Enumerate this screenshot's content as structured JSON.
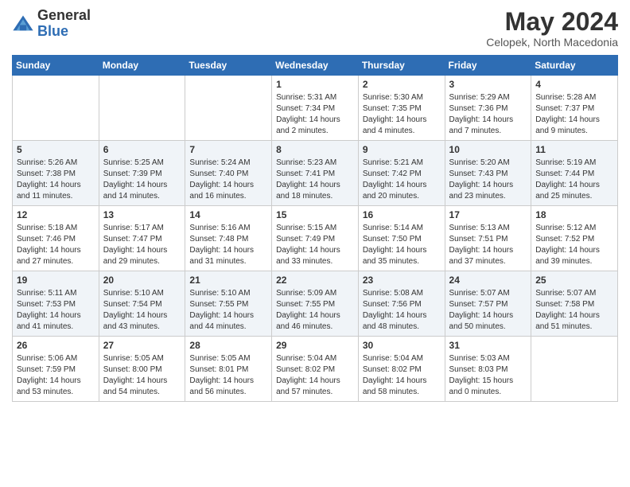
{
  "header": {
    "logo": {
      "line1": "General",
      "line2": "Blue"
    },
    "month_year": "May 2024",
    "location": "Celopek, North Macedonia"
  },
  "days_of_week": [
    "Sunday",
    "Monday",
    "Tuesday",
    "Wednesday",
    "Thursday",
    "Friday",
    "Saturday"
  ],
  "weeks": [
    [
      {
        "day": "",
        "info": ""
      },
      {
        "day": "",
        "info": ""
      },
      {
        "day": "",
        "info": ""
      },
      {
        "day": "1",
        "sunrise": "5:31 AM",
        "sunset": "7:34 PM",
        "daylight": "14 hours and 2 minutes."
      },
      {
        "day": "2",
        "sunrise": "5:30 AM",
        "sunset": "7:35 PM",
        "daylight": "14 hours and 4 minutes."
      },
      {
        "day": "3",
        "sunrise": "5:29 AM",
        "sunset": "7:36 PM",
        "daylight": "14 hours and 7 minutes."
      },
      {
        "day": "4",
        "sunrise": "5:28 AM",
        "sunset": "7:37 PM",
        "daylight": "14 hours and 9 minutes."
      }
    ],
    [
      {
        "day": "5",
        "sunrise": "5:26 AM",
        "sunset": "7:38 PM",
        "daylight": "14 hours and 11 minutes."
      },
      {
        "day": "6",
        "sunrise": "5:25 AM",
        "sunset": "7:39 PM",
        "daylight": "14 hours and 14 minutes."
      },
      {
        "day": "7",
        "sunrise": "5:24 AM",
        "sunset": "7:40 PM",
        "daylight": "14 hours and 16 minutes."
      },
      {
        "day": "8",
        "sunrise": "5:23 AM",
        "sunset": "7:41 PM",
        "daylight": "14 hours and 18 minutes."
      },
      {
        "day": "9",
        "sunrise": "5:21 AM",
        "sunset": "7:42 PM",
        "daylight": "14 hours and 20 minutes."
      },
      {
        "day": "10",
        "sunrise": "5:20 AM",
        "sunset": "7:43 PM",
        "daylight": "14 hours and 23 minutes."
      },
      {
        "day": "11",
        "sunrise": "5:19 AM",
        "sunset": "7:44 PM",
        "daylight": "14 hours and 25 minutes."
      }
    ],
    [
      {
        "day": "12",
        "sunrise": "5:18 AM",
        "sunset": "7:46 PM",
        "daylight": "14 hours and 27 minutes."
      },
      {
        "day": "13",
        "sunrise": "5:17 AM",
        "sunset": "7:47 PM",
        "daylight": "14 hours and 29 minutes."
      },
      {
        "day": "14",
        "sunrise": "5:16 AM",
        "sunset": "7:48 PM",
        "daylight": "14 hours and 31 minutes."
      },
      {
        "day": "15",
        "sunrise": "5:15 AM",
        "sunset": "7:49 PM",
        "daylight": "14 hours and 33 minutes."
      },
      {
        "day": "16",
        "sunrise": "5:14 AM",
        "sunset": "7:50 PM",
        "daylight": "14 hours and 35 minutes."
      },
      {
        "day": "17",
        "sunrise": "5:13 AM",
        "sunset": "7:51 PM",
        "daylight": "14 hours and 37 minutes."
      },
      {
        "day": "18",
        "sunrise": "5:12 AM",
        "sunset": "7:52 PM",
        "daylight": "14 hours and 39 minutes."
      }
    ],
    [
      {
        "day": "19",
        "sunrise": "5:11 AM",
        "sunset": "7:53 PM",
        "daylight": "14 hours and 41 minutes."
      },
      {
        "day": "20",
        "sunrise": "5:10 AM",
        "sunset": "7:54 PM",
        "daylight": "14 hours and 43 minutes."
      },
      {
        "day": "21",
        "sunrise": "5:10 AM",
        "sunset": "7:55 PM",
        "daylight": "14 hours and 44 minutes."
      },
      {
        "day": "22",
        "sunrise": "5:09 AM",
        "sunset": "7:55 PM",
        "daylight": "14 hours and 46 minutes."
      },
      {
        "day": "23",
        "sunrise": "5:08 AM",
        "sunset": "7:56 PM",
        "daylight": "14 hours and 48 minutes."
      },
      {
        "day": "24",
        "sunrise": "5:07 AM",
        "sunset": "7:57 PM",
        "daylight": "14 hours and 50 minutes."
      },
      {
        "day": "25",
        "sunrise": "5:07 AM",
        "sunset": "7:58 PM",
        "daylight": "14 hours and 51 minutes."
      }
    ],
    [
      {
        "day": "26",
        "sunrise": "5:06 AM",
        "sunset": "7:59 PM",
        "daylight": "14 hours and 53 minutes."
      },
      {
        "day": "27",
        "sunrise": "5:05 AM",
        "sunset": "8:00 PM",
        "daylight": "14 hours and 54 minutes."
      },
      {
        "day": "28",
        "sunrise": "5:05 AM",
        "sunset": "8:01 PM",
        "daylight": "14 hours and 56 minutes."
      },
      {
        "day": "29",
        "sunrise": "5:04 AM",
        "sunset": "8:02 PM",
        "daylight": "14 hours and 57 minutes."
      },
      {
        "day": "30",
        "sunrise": "5:04 AM",
        "sunset": "8:02 PM",
        "daylight": "14 hours and 58 minutes."
      },
      {
        "day": "31",
        "sunrise": "5:03 AM",
        "sunset": "8:03 PM",
        "daylight": "15 hours and 0 minutes."
      },
      {
        "day": "",
        "info": ""
      }
    ]
  ],
  "labels": {
    "sunrise": "Sunrise:",
    "sunset": "Sunset:",
    "daylight": "Daylight:"
  }
}
